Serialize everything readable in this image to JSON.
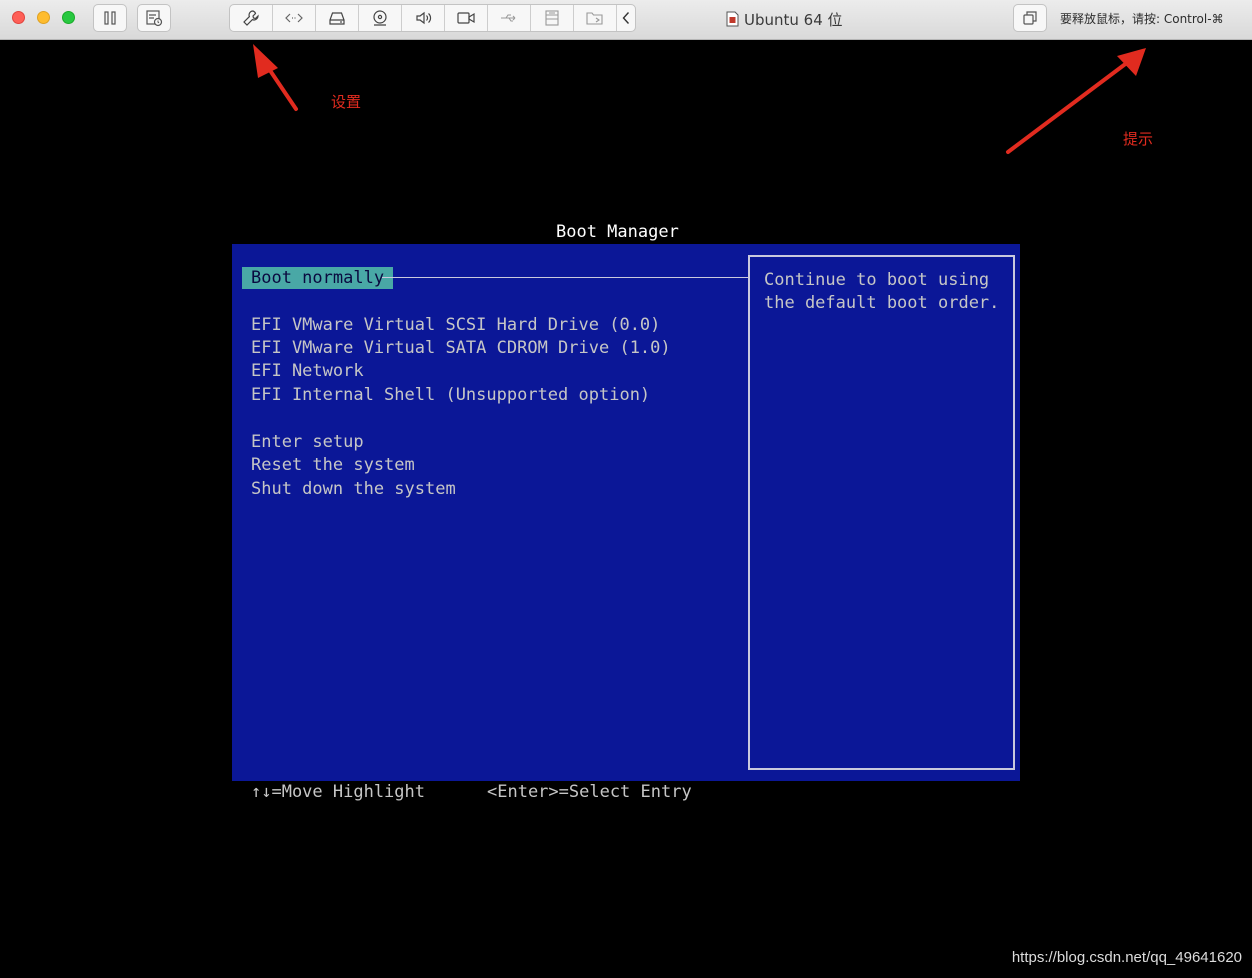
{
  "window": {
    "title": "Ubuntu 64 位",
    "hint": "要释放鼠标，请按: Control-⌘"
  },
  "toolbar": {
    "icons": [
      "pause-icon",
      "snapshot-icon",
      "wrench-icon",
      "network-icon",
      "hard-disk-icon",
      "cdrom-icon",
      "sound-icon",
      "camera-icon",
      "usb-icon",
      "printer-icon",
      "shared-folder-icon",
      "chevron-left-icon",
      "fullscreen-icon"
    ]
  },
  "annotations": {
    "settings_label": "设置",
    "hint_label": "提示",
    "color": "#e12b1f"
  },
  "boot_manager": {
    "title": "Boot Manager",
    "selected": "Boot normally",
    "devices": [
      "EFI VMware Virtual SCSI Hard Drive (0.0)",
      "EFI VMware Virtual SATA CDROM Drive (1.0)",
      "EFI Network",
      "EFI Internal Shell (Unsupported option)"
    ],
    "actions": [
      "Enter setup",
      "Reset the system",
      "Shut down the system"
    ],
    "help_line1": "Continue to boot using",
    "help_line2": "the default boot order.",
    "footer_move": "↑↓=Move Highlight",
    "footer_select": "<Enter>=Select Entry",
    "colors": {
      "panel": "#0b1797",
      "highlight": "#49a8a6",
      "text": "#c6c6c6"
    }
  },
  "watermark": "https://blog.csdn.net/qq_49641620"
}
